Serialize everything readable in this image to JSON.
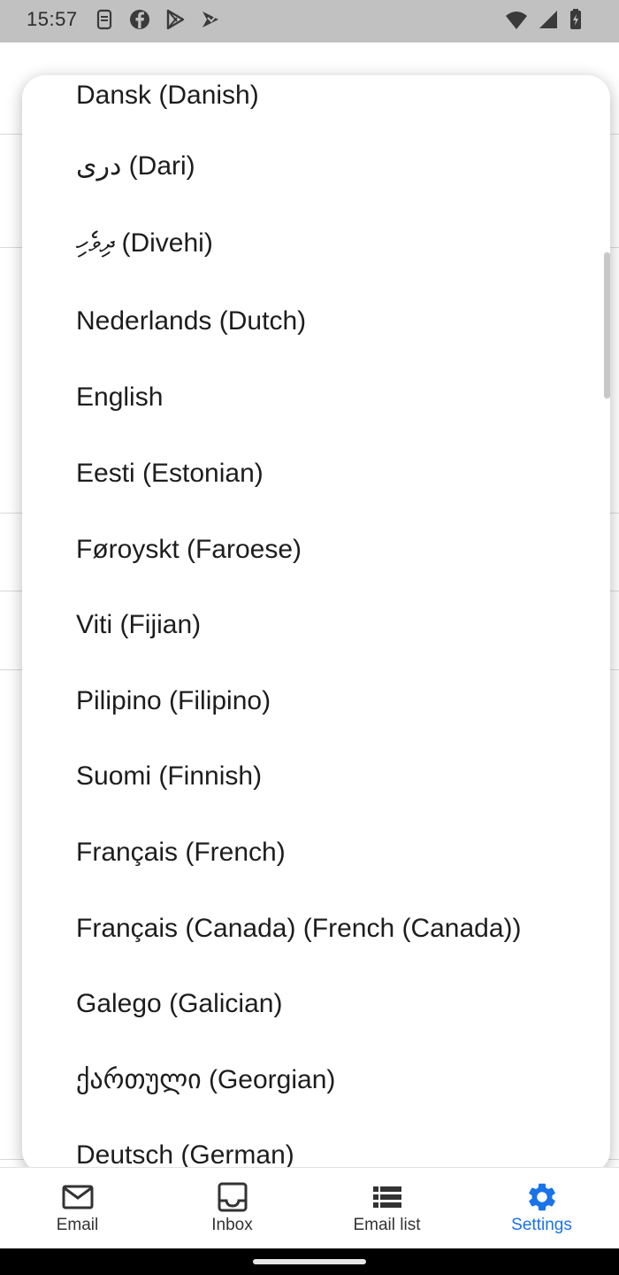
{
  "status_bar": {
    "time": "15:57",
    "left_icons": [
      "sim-icon",
      "facebook-icon",
      "play-store-icon",
      "play-games-icon"
    ],
    "right_icons": [
      "wifi-icon",
      "signal-icon",
      "battery-icon"
    ]
  },
  "language_dialog": {
    "items": [
      {
        "label": "Dansk (Danish)"
      },
      {
        "label": "دری (Dari)"
      },
      {
        "label": "ދިވެހި (Divehi)"
      },
      {
        "label": "Nederlands (Dutch)"
      },
      {
        "label": "English"
      },
      {
        "label": "Eesti (Estonian)"
      },
      {
        "label": "Føroyskt (Faroese)"
      },
      {
        "label": "Viti (Fijian)"
      },
      {
        "label": "Pilipino (Filipino)"
      },
      {
        "label": "Suomi (Finnish)"
      },
      {
        "label": "Français (French)"
      },
      {
        "label": "Français (Canada) (French (Canada))"
      },
      {
        "label": "Galego (Galician)"
      },
      {
        "label": "ქართული (Georgian)"
      },
      {
        "label": "Deutsch (German)"
      }
    ]
  },
  "bottom_nav": {
    "items": [
      {
        "label": "Email",
        "icon": "mail-icon"
      },
      {
        "label": "Inbox",
        "icon": "inbox-icon"
      },
      {
        "label": "Email list",
        "icon": "list-icon"
      },
      {
        "label": "Settings",
        "icon": "gear-icon"
      }
    ],
    "active_color": "#1a73e8"
  }
}
